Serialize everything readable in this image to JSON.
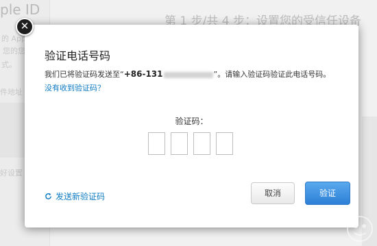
{
  "background": {
    "apple_id_fragment": "ple ID",
    "step_title": "第 1 步/共 4 步：设置您的受信任设备",
    "faint_lines": [
      "的 Appl",
      "您的您",
      "式。",
      "件地址",
      "好设置"
    ]
  },
  "modal": {
    "title": "验证电话号码",
    "desc_prefix": "我们已将验证码发送至“",
    "phone_prefix": "+86-131",
    "desc_suffix": "”。请输入验证码验证此电话号码。",
    "not_received_link": "没有收到验证码？",
    "code_label": "验证码：",
    "resend_label": "发送新验证码",
    "cancel_label": "取消",
    "verify_label": "验证"
  },
  "icons": {
    "close": "close-icon",
    "refresh": "refresh-icon"
  },
  "colors": {
    "link": "#0f7bc4",
    "primary_button": "#2c7fd6"
  }
}
